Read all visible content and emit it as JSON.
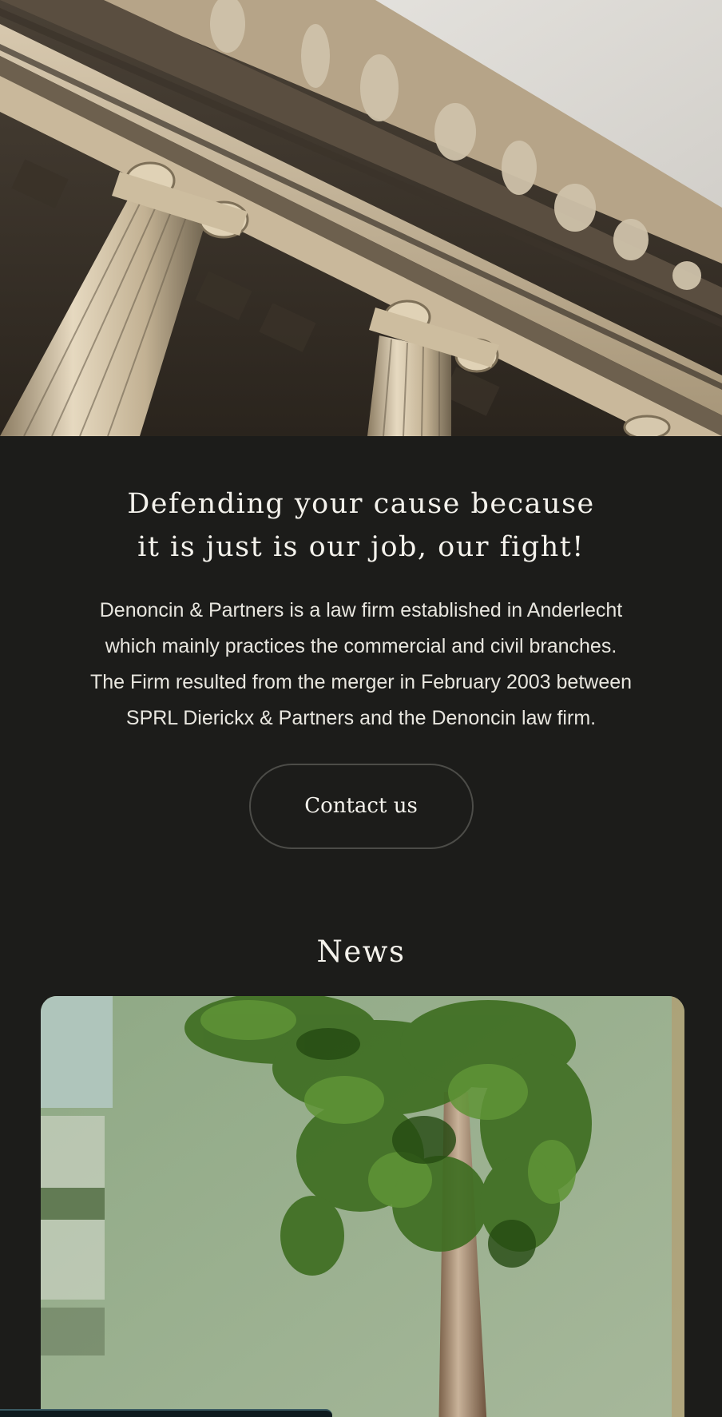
{
  "hero": {
    "image_alt": "Classical courthouse facade with columns and statues"
  },
  "intro": {
    "headline_line1": "Defending your cause because",
    "headline_line2": "it is just is our job, our fight!",
    "paragraph_lines": [
      "Denoncin & Partners is a law firm established in Anderlecht",
      "which mainly practices the commercial and civil branches.",
      "The Firm resulted from the merger in February 2003 between",
      "SPRL Dierickx & Partners and the Denoncin law firm."
    ],
    "contact_label": "Contact us"
  },
  "news": {
    "title": "News",
    "card_image_alt": "Young tree with green leaves against pale green wall"
  },
  "colors": {
    "background": "#1c1c1a",
    "text": "#f2f0ea",
    "button_border": "#4c4c48"
  }
}
